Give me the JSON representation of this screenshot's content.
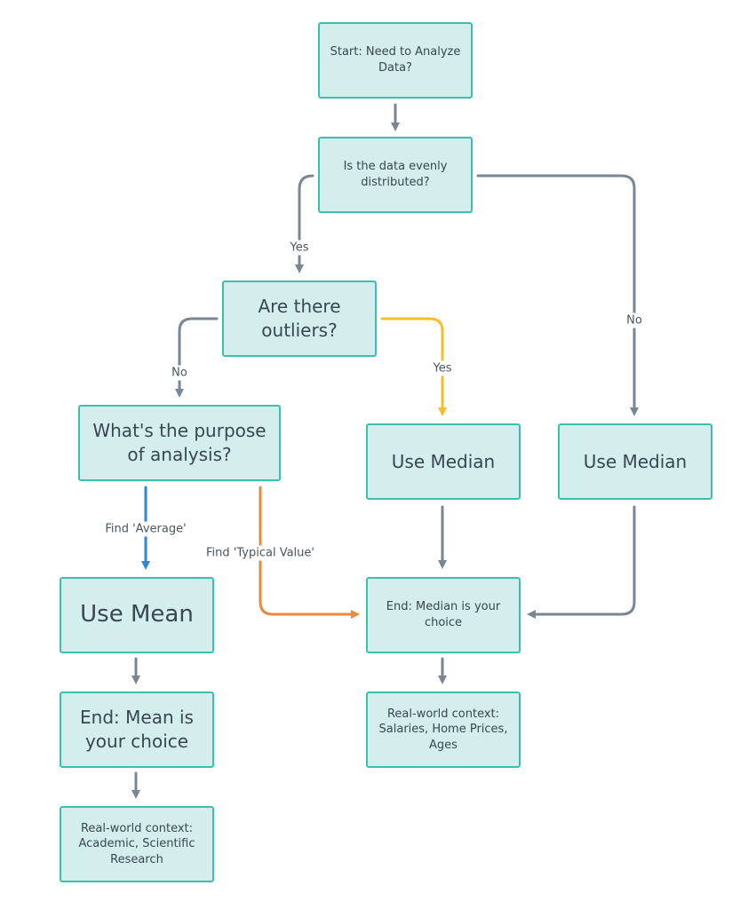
{
  "colors": {
    "node_fill": "#d3eeec",
    "node_border": "#3dbfae",
    "text": "#3a4652",
    "edge_default": "#7a8694",
    "edge_yes_outliers": "#f5bf2a",
    "edge_average": "#2e86d6",
    "edge_typical": "#ea8a3c"
  },
  "nodes": {
    "start": "Start: Need to Analyze Data?",
    "evenly": "Is the data evenly distributed?",
    "outliers": "Are there outliers?",
    "purpose": "What's the purpose of analysis?",
    "median_outliers": "Use Median",
    "median_uneven": "Use Median",
    "use_mean": "Use Mean",
    "end_median": "End: Median is your choice",
    "end_mean": "End: Mean is your choice",
    "context_median": "Real-world context: Salaries, Home Prices, Ages",
    "context_mean": "Real-world context: Academic, Scientific Research"
  },
  "edge_labels": {
    "evenly_yes": "Yes",
    "evenly_no": "No",
    "outliers_no": "No",
    "outliers_yes": "Yes",
    "purpose_average": "Find 'Average'",
    "purpose_typical": "Find 'Typical Value'"
  }
}
